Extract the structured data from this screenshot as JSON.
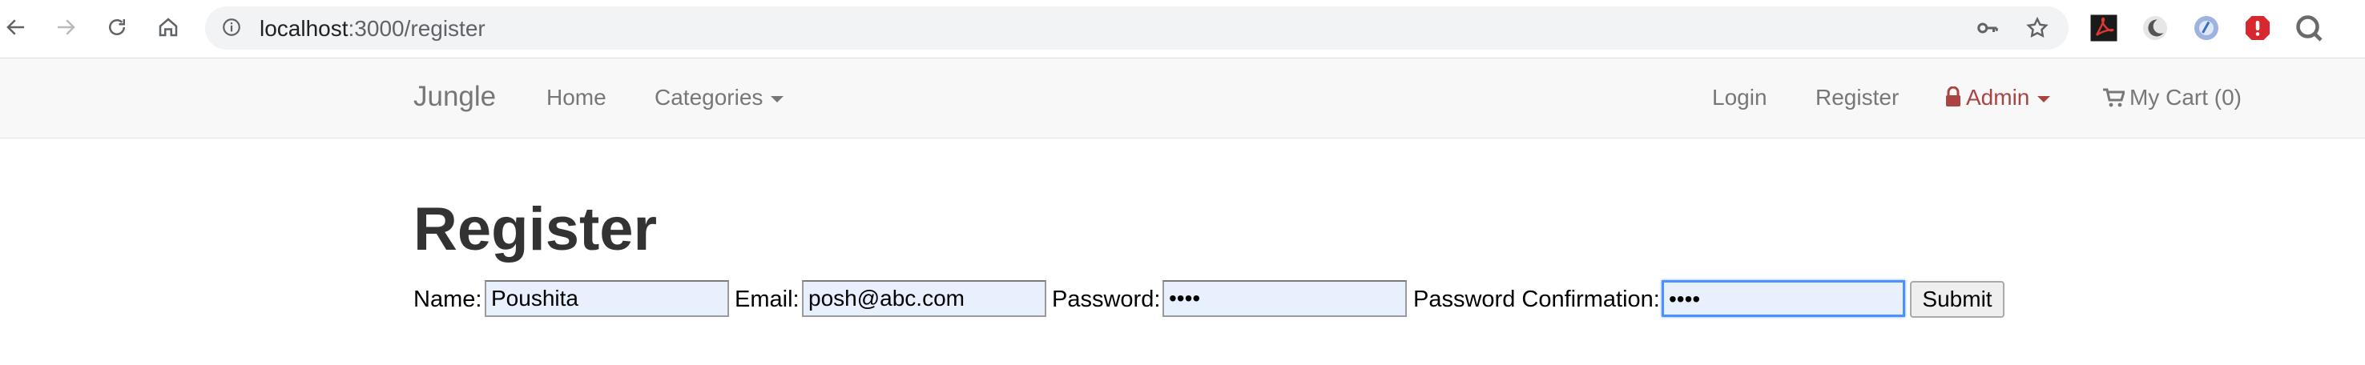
{
  "browser": {
    "url_host": "localhost",
    "url_path": ":3000/register"
  },
  "navbar": {
    "brand": "Jungle",
    "home": "Home",
    "categories": "Categories",
    "login": "Login",
    "register": "Register",
    "admin": "Admin",
    "cart": "My Cart (0)",
    "admin_color": "#a94442"
  },
  "page": {
    "title": "Register"
  },
  "form": {
    "name_label": "Name:",
    "name_value": "Poushita",
    "email_label": "Email:",
    "email_value": "posh@abc.com",
    "password_label": "Password:",
    "password_value": "••••",
    "confirm_label": "Password Confirmation:",
    "confirm_value": "••••",
    "submit_label": "Submit"
  }
}
